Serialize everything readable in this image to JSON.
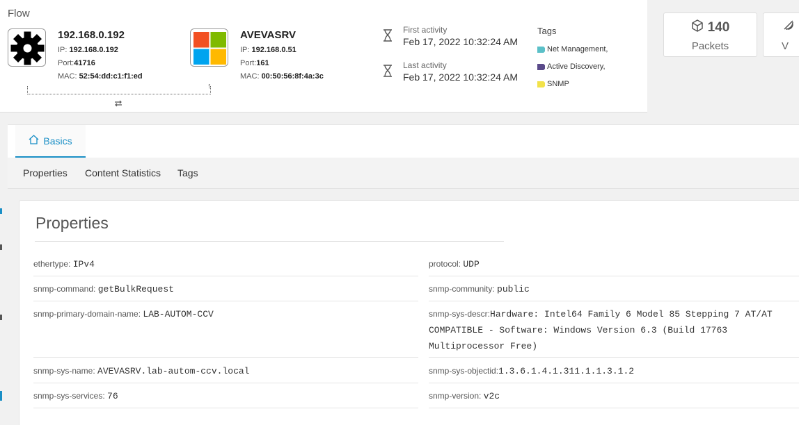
{
  "flow": {
    "title": "Flow",
    "source": {
      "name": "192.168.0.192",
      "ip_label": "IP: ",
      "ip": "192.168.0.192",
      "port_label": "Port:",
      "port": "41716",
      "mac_label": "MAC: ",
      "mac": "52:54:dd:c1:f1:ed",
      "icon": "gear-icon"
    },
    "destination": {
      "name": "AVEVASRV",
      "ip_label": "IP: ",
      "ip": "192.168.0.51",
      "port_label": "Port:",
      "port": "161",
      "mac_label": "MAC: ",
      "mac": "00:50:56:8f:4a:3c",
      "icon": "windows-logo-icon"
    },
    "first_activity": {
      "label": "First activity",
      "value": "Feb 17, 2022 10:32:24 AM"
    },
    "last_activity": {
      "label": "Last activity",
      "value": "Feb 17, 2022 10:32:24 AM"
    },
    "tags": {
      "title": "Tags",
      "items": [
        {
          "label": "Net Management,",
          "color": "#5bc0c8"
        },
        {
          "label": "Active Discovery,",
          "color": "#5a4a8a"
        },
        {
          "label": "SNMP",
          "color": "#f2e24a"
        }
      ]
    }
  },
  "stats": {
    "packets": {
      "value": "140",
      "label": "Packets"
    },
    "second": {
      "label": "V"
    }
  },
  "tabs": {
    "basics": "Basics"
  },
  "subnav": [
    "Properties",
    "Content Statistics",
    "Tags"
  ],
  "properties": {
    "title": "Properties",
    "left": [
      {
        "key": "ethertype:",
        "value": "IPv4"
      },
      {
        "key": "snmp-command:",
        "value": "getBulkRequest"
      },
      {
        "key": "snmp-primary-domain-name:",
        "value": "LAB-AUTOM-CCV"
      },
      {
        "key": "snmp-sys-name:",
        "value": "AVEVASRV.lab-autom-ccv.local"
      },
      {
        "key": "snmp-sys-services:",
        "value": "76"
      }
    ],
    "right": [
      {
        "key": "protocol:",
        "value": "UDP"
      },
      {
        "key": "snmp-community:",
        "value": "public"
      },
      {
        "key": "snmp-sys-descr:",
        "value": "Hardware: Intel64 Family 6 Model 85 Stepping 7 AT/AT",
        "value2": "COMPATIBLE - Software: Windows Version 6.3 (Build 17763",
        "value3": "Multiprocessor Free)"
      },
      {
        "key": "snmp-sys-objectid:",
        "value": "1.3.6.1.4.1.311.1.1.3.1.2"
      },
      {
        "key": "snmp-version:",
        "value": "v2c"
      }
    ]
  },
  "colors": {
    "accent": "#1a8fc6"
  }
}
